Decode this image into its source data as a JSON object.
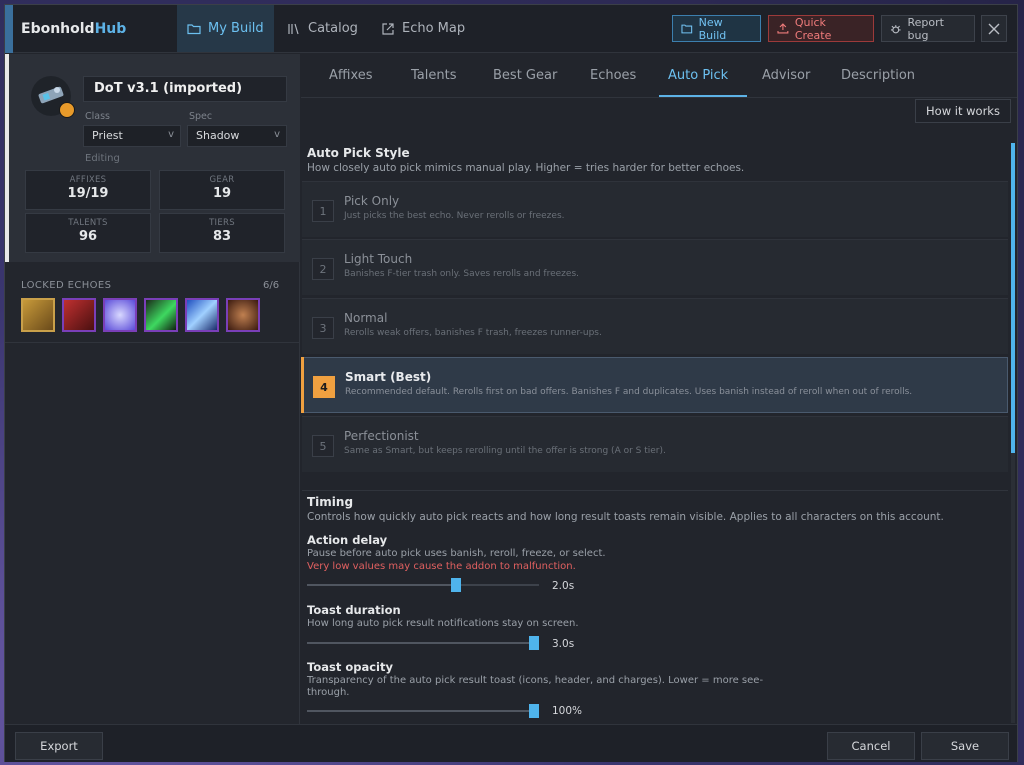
{
  "app": {
    "brand_part1": "Ebonhold",
    "brand_part2": "Hub"
  },
  "nav": {
    "tabs": [
      {
        "label": "My Build",
        "icon": "folder-icon",
        "active": true
      },
      {
        "label": "Catalog",
        "icon": "library-icon",
        "active": false
      },
      {
        "label": "Echo Map",
        "icon": "external-link-icon",
        "active": false
      }
    ],
    "new_build": "New Build",
    "quick_create": "Quick Create",
    "report_bug": "Report bug"
  },
  "build": {
    "name": "DoT v3.1 (imported)",
    "class_label": "Class",
    "class_value": "Priest",
    "spec_label": "Spec",
    "spec_value": "Shadow",
    "editing": "Editing",
    "stats": [
      {
        "label": "AFFIXES",
        "value": "19/19"
      },
      {
        "label": "GEAR",
        "value": "19"
      },
      {
        "label": "TALENTS",
        "value": "96"
      },
      {
        "label": "TIERS",
        "value": "83"
      }
    ],
    "locked_echoes_label": "LOCKED ECHOES",
    "locked_echoes_count": "6/6"
  },
  "tabs": {
    "items": [
      "Affixes",
      "Talents",
      "Best Gear",
      "Echoes",
      "Auto Pick",
      "Advisor",
      "Description"
    ],
    "active": "Auto Pick"
  },
  "autopick": {
    "how_it_works": "How it works",
    "style_title": "Auto Pick Style",
    "style_desc": "How closely auto pick mimics manual play. Higher = tries harder for better echoes.",
    "options": [
      {
        "num": "1",
        "title": "Pick Only",
        "desc": "Just picks the best echo. Never rerolls or freezes."
      },
      {
        "num": "2",
        "title": "Light Touch",
        "desc": "Banishes F-tier trash only. Saves rerolls and freezes."
      },
      {
        "num": "3",
        "title": "Normal",
        "desc": "Rerolls weak offers, banishes F trash, freezes runner-ups."
      },
      {
        "num": "4",
        "title": "Smart (Best)",
        "desc": "Recommended default. Rerolls first on bad offers. Banishes F and duplicates. Uses banish instead of reroll when out of rerolls."
      },
      {
        "num": "5",
        "title": "Perfectionist",
        "desc": "Same as Smart, but keeps rerolling until the offer is strong (A or S tier)."
      }
    ],
    "selected": "4",
    "timing_title": "Timing",
    "timing_desc": "Controls how quickly auto pick reacts and how long result toasts remain visible. Applies to all characters on this account.",
    "action_delay": {
      "title": "Action delay",
      "desc": "Pause before auto pick uses banish, reroll, freeze, or select.",
      "warning": "Very low values may cause the addon to malfunction.",
      "value": "2.0s",
      "fraction": 0.65
    },
    "toast_duration": {
      "title": "Toast duration",
      "desc": "How long auto pick result notifications stay on screen.",
      "value": "3.0s",
      "fraction": 1.0
    },
    "toast_opacity": {
      "title": "Toast opacity",
      "desc": "Transparency of the auto pick result toast (icons, header, and charges). Lower = more see-through.",
      "value": "100%",
      "fraction": 1.0
    }
  },
  "footer": {
    "export": "Export",
    "cancel": "Cancel",
    "save": "Save"
  }
}
